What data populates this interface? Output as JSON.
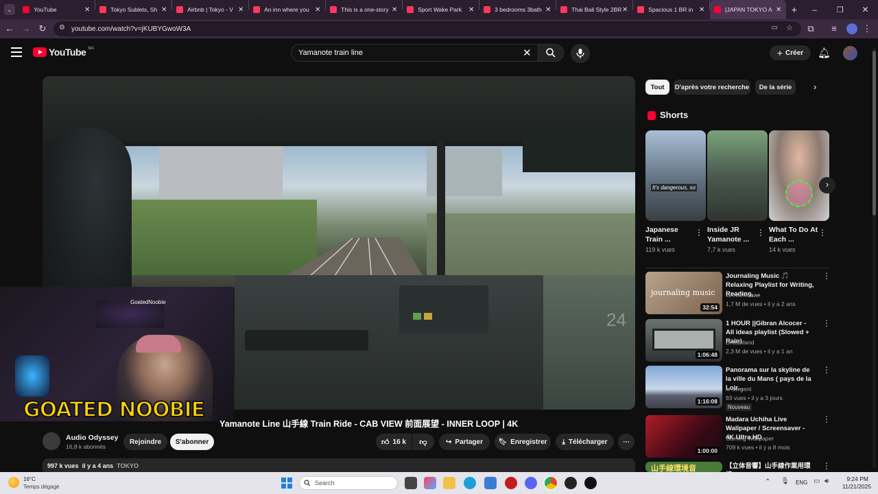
{
  "browser": {
    "tabs": [
      {
        "title": "YouTube",
        "color": "#ff0033"
      },
      {
        "title": "Tokyo Sublets, Sh",
        "color": "#ff385c"
      },
      {
        "title": "Airbnb | Tokyo - V",
        "color": "#ff385c"
      },
      {
        "title": "An inn where you",
        "color": "#ff385c"
      },
      {
        "title": "This is a one-story",
        "color": "#ff385c"
      },
      {
        "title": "Sport Wake Park ",
        "color": "#ff385c"
      },
      {
        "title": "3 bedrooms 3bath",
        "color": "#ff385c"
      },
      {
        "title": "Thai Bali Style 2BR",
        "color": "#ff385c"
      },
      {
        "title": "Spacious 1 BR in ",
        "color": "#ff385c"
      },
      {
        "title": "[JAPAN TOKYO A",
        "color": "#ff0033"
      }
    ],
    "url": "youtube.com/watch?v=jKUBYGwoW3A",
    "new_tab": "+"
  },
  "youtube": {
    "logo_text": "YouTube",
    "region": "MA",
    "search_value": "Yamanote train line",
    "create_label": "Créer"
  },
  "video": {
    "title_visible": "Yamanote Line 山手線 Train Ride - CAB VIEW 前面展望 - INNER LOOP | 4K",
    "overlay_text": "GOATED NOOBIE",
    "overlay_small": "GoatedNoobie",
    "cab_number": "24",
    "channel_name": "Audio Odyssey",
    "subscribers": "16,8 k abonnés",
    "join_label": "Rejoindre",
    "subscribe_label": "S'abonner",
    "likes": "16 k",
    "share_label": "Partager",
    "save_label": "Enregistrer",
    "download_label": "Télécharger",
    "views": "997 k vues",
    "age": "il y a 4 ans",
    "tag": "TOKYO"
  },
  "sidebar": {
    "chips": [
      "Tout",
      "D'après votre recherche",
      "De la série"
    ],
    "shorts_heading": "Shorts",
    "shorts": [
      {
        "title": "Japanese Train ...",
        "views": "119 k vues",
        "caption": "It's dangerous, so"
      },
      {
        "title": "Inside JR Yamanote ...",
        "views": "7,7 k vues"
      },
      {
        "title": "What To Do At Each ...",
        "views": "14 k vues"
      }
    ],
    "recommendations": [
      {
        "title": "Journaling Music 🎵 Relaxing Playlist for Writing, Reading, ...",
        "channel": "iamvanessae",
        "meta": "1,7 M de vues • il y a 2 ans",
        "duration": "32:54",
        "thumb_text": "journaling music"
      },
      {
        "title": "1 HOUR ||Gibran Alcocer - All ideas playlist (Slowed + Rain)",
        "channel": "Dreamland",
        "meta": "2,3 M de vues • il y a 1 an",
        "duration": "1:06:48"
      },
      {
        "title": "Panorama sur la skyline de la ville du Mans ( pays de la Loir...",
        "channel": "le sergent",
        "meta": "93 vues • il y a 3 jours",
        "duration": "1:16:08",
        "badge": "Nouveau"
      },
      {
        "title": "Madara Uchiha Live Wallpaper / Screensaver - 4K Ultra HD",
        "channel": "Gaming Wallpaper",
        "meta": "709 k vues • il y a 8 mois",
        "duration": "1:00:00"
      },
      {
        "title": "【立体音響】山手線作業用環境",
        "thumb_text": "山手線環境音"
      }
    ]
  },
  "taskbar": {
    "weather_temp": "16°C",
    "weather_desc": "Temps dégagé",
    "search_placeholder": "Search",
    "lang": "ENG",
    "time": "9:24 PM",
    "date": "11/21/2025"
  }
}
